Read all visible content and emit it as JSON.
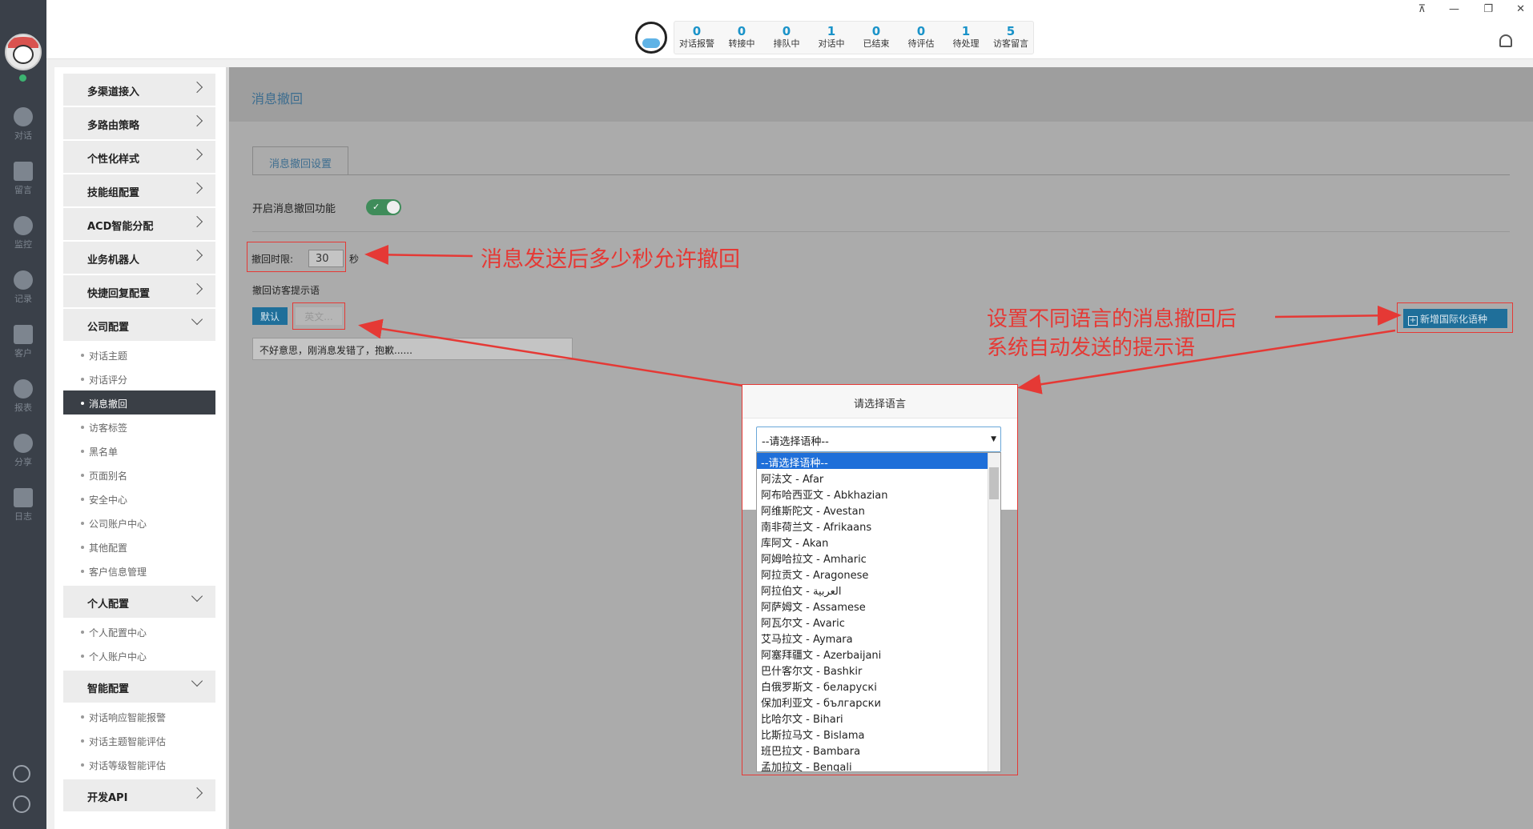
{
  "nav": {
    "items": [
      "对话",
      "留言",
      "监控",
      "记录",
      "客户",
      "报表",
      "分享",
      "日志"
    ]
  },
  "header": {
    "stats": [
      {
        "num": "0",
        "label": "对话报警"
      },
      {
        "num": "0",
        "label": "转接中"
      },
      {
        "num": "0",
        "label": "排队中"
      },
      {
        "num": "1",
        "label": "对话中"
      },
      {
        "num": "0",
        "label": "已结束"
      },
      {
        "num": "0",
        "label": "待评估"
      },
      {
        "num": "1",
        "label": "待处理"
      },
      {
        "num": "5",
        "label": "访客留言"
      }
    ],
    "win_pin": "⊼",
    "win_min": "—",
    "win_restore": "❐",
    "win_close": "✕"
  },
  "sidebar": {
    "groups": [
      {
        "label": "多渠道接入",
        "expanded": false
      },
      {
        "label": "多路由策略",
        "expanded": false
      },
      {
        "label": "个性化样式",
        "expanded": false
      },
      {
        "label": "技能组配置",
        "expanded": false
      },
      {
        "label": "ACD智能分配",
        "expanded": false
      },
      {
        "label": "业务机器人",
        "expanded": false
      },
      {
        "label": "快捷回复配置",
        "expanded": false
      },
      {
        "label": "公司配置",
        "expanded": true
      },
      {
        "label": "个人配置",
        "expanded": true
      },
      {
        "label": "智能配置",
        "expanded": true
      },
      {
        "label": "开发API",
        "expanded": false
      }
    ],
    "company_items": [
      "对话主题",
      "对话评分",
      "消息撤回",
      "访客标签",
      "黑名单",
      "页面别名",
      "安全中心",
      "公司账户中心",
      "其他配置",
      "客户信息管理"
    ],
    "personal_items": [
      "个人配置中心",
      "个人账户中心"
    ],
    "smart_items": [
      "对话响应智能报警",
      "对话主题智能评估",
      "对话等级智能评估"
    ]
  },
  "main": {
    "title": "消息撤回",
    "tab": "消息撤回设置",
    "enable_label": "开启消息撤回功能",
    "toggle_on": true,
    "time_label": "撤回时限:",
    "time_value": "30",
    "time_unit": "秒",
    "prompt_label": "撤回访客提示语",
    "btn_default": "默认",
    "btn_english": "英文...",
    "prompt_text": "不好意思，刚消息发错了，抱歉......",
    "btn_add_intl": "新增国际化语种"
  },
  "annotations": {
    "time_note": "消息发送后多少秒允许撤回",
    "lang_note_1": "设置不同语言的消息撤回后",
    "lang_note_2": "系统自动发送的提示语"
  },
  "modal": {
    "title": "请选择语言",
    "select_value": "--请选择语种--",
    "options": [
      "--请选择语种--",
      "阿法文 - Afar",
      "阿布哈西亚文 - Abkhazian",
      "阿维斯陀文 - Avestan",
      "南非荷兰文 - Afrikaans",
      "库阿文 - Akan",
      "阿姆哈拉文 - Amharic",
      "阿拉贡文 - Aragonese",
      "阿拉伯文 - العربية",
      "阿萨姆文 - Assamese",
      "阿瓦尔文 - Avaric",
      "艾马拉文 - Aymara",
      "阿塞拜疆文 - Azerbaijani",
      "巴什客尔文 - Bashkir",
      "白俄罗斯文 - беларускі",
      "保加利亚文 - български",
      "比哈尔文 - Bihari",
      "比斯拉马文 - Bislama",
      "班巴拉文 - Bambara",
      "孟加拉文 - Bengali"
    ]
  },
  "colors": {
    "accent": "#1a93c9",
    "annotation_red": "#e53935",
    "toggle_green": "#3f8c5a",
    "nav_bg": "#3a4049"
  }
}
